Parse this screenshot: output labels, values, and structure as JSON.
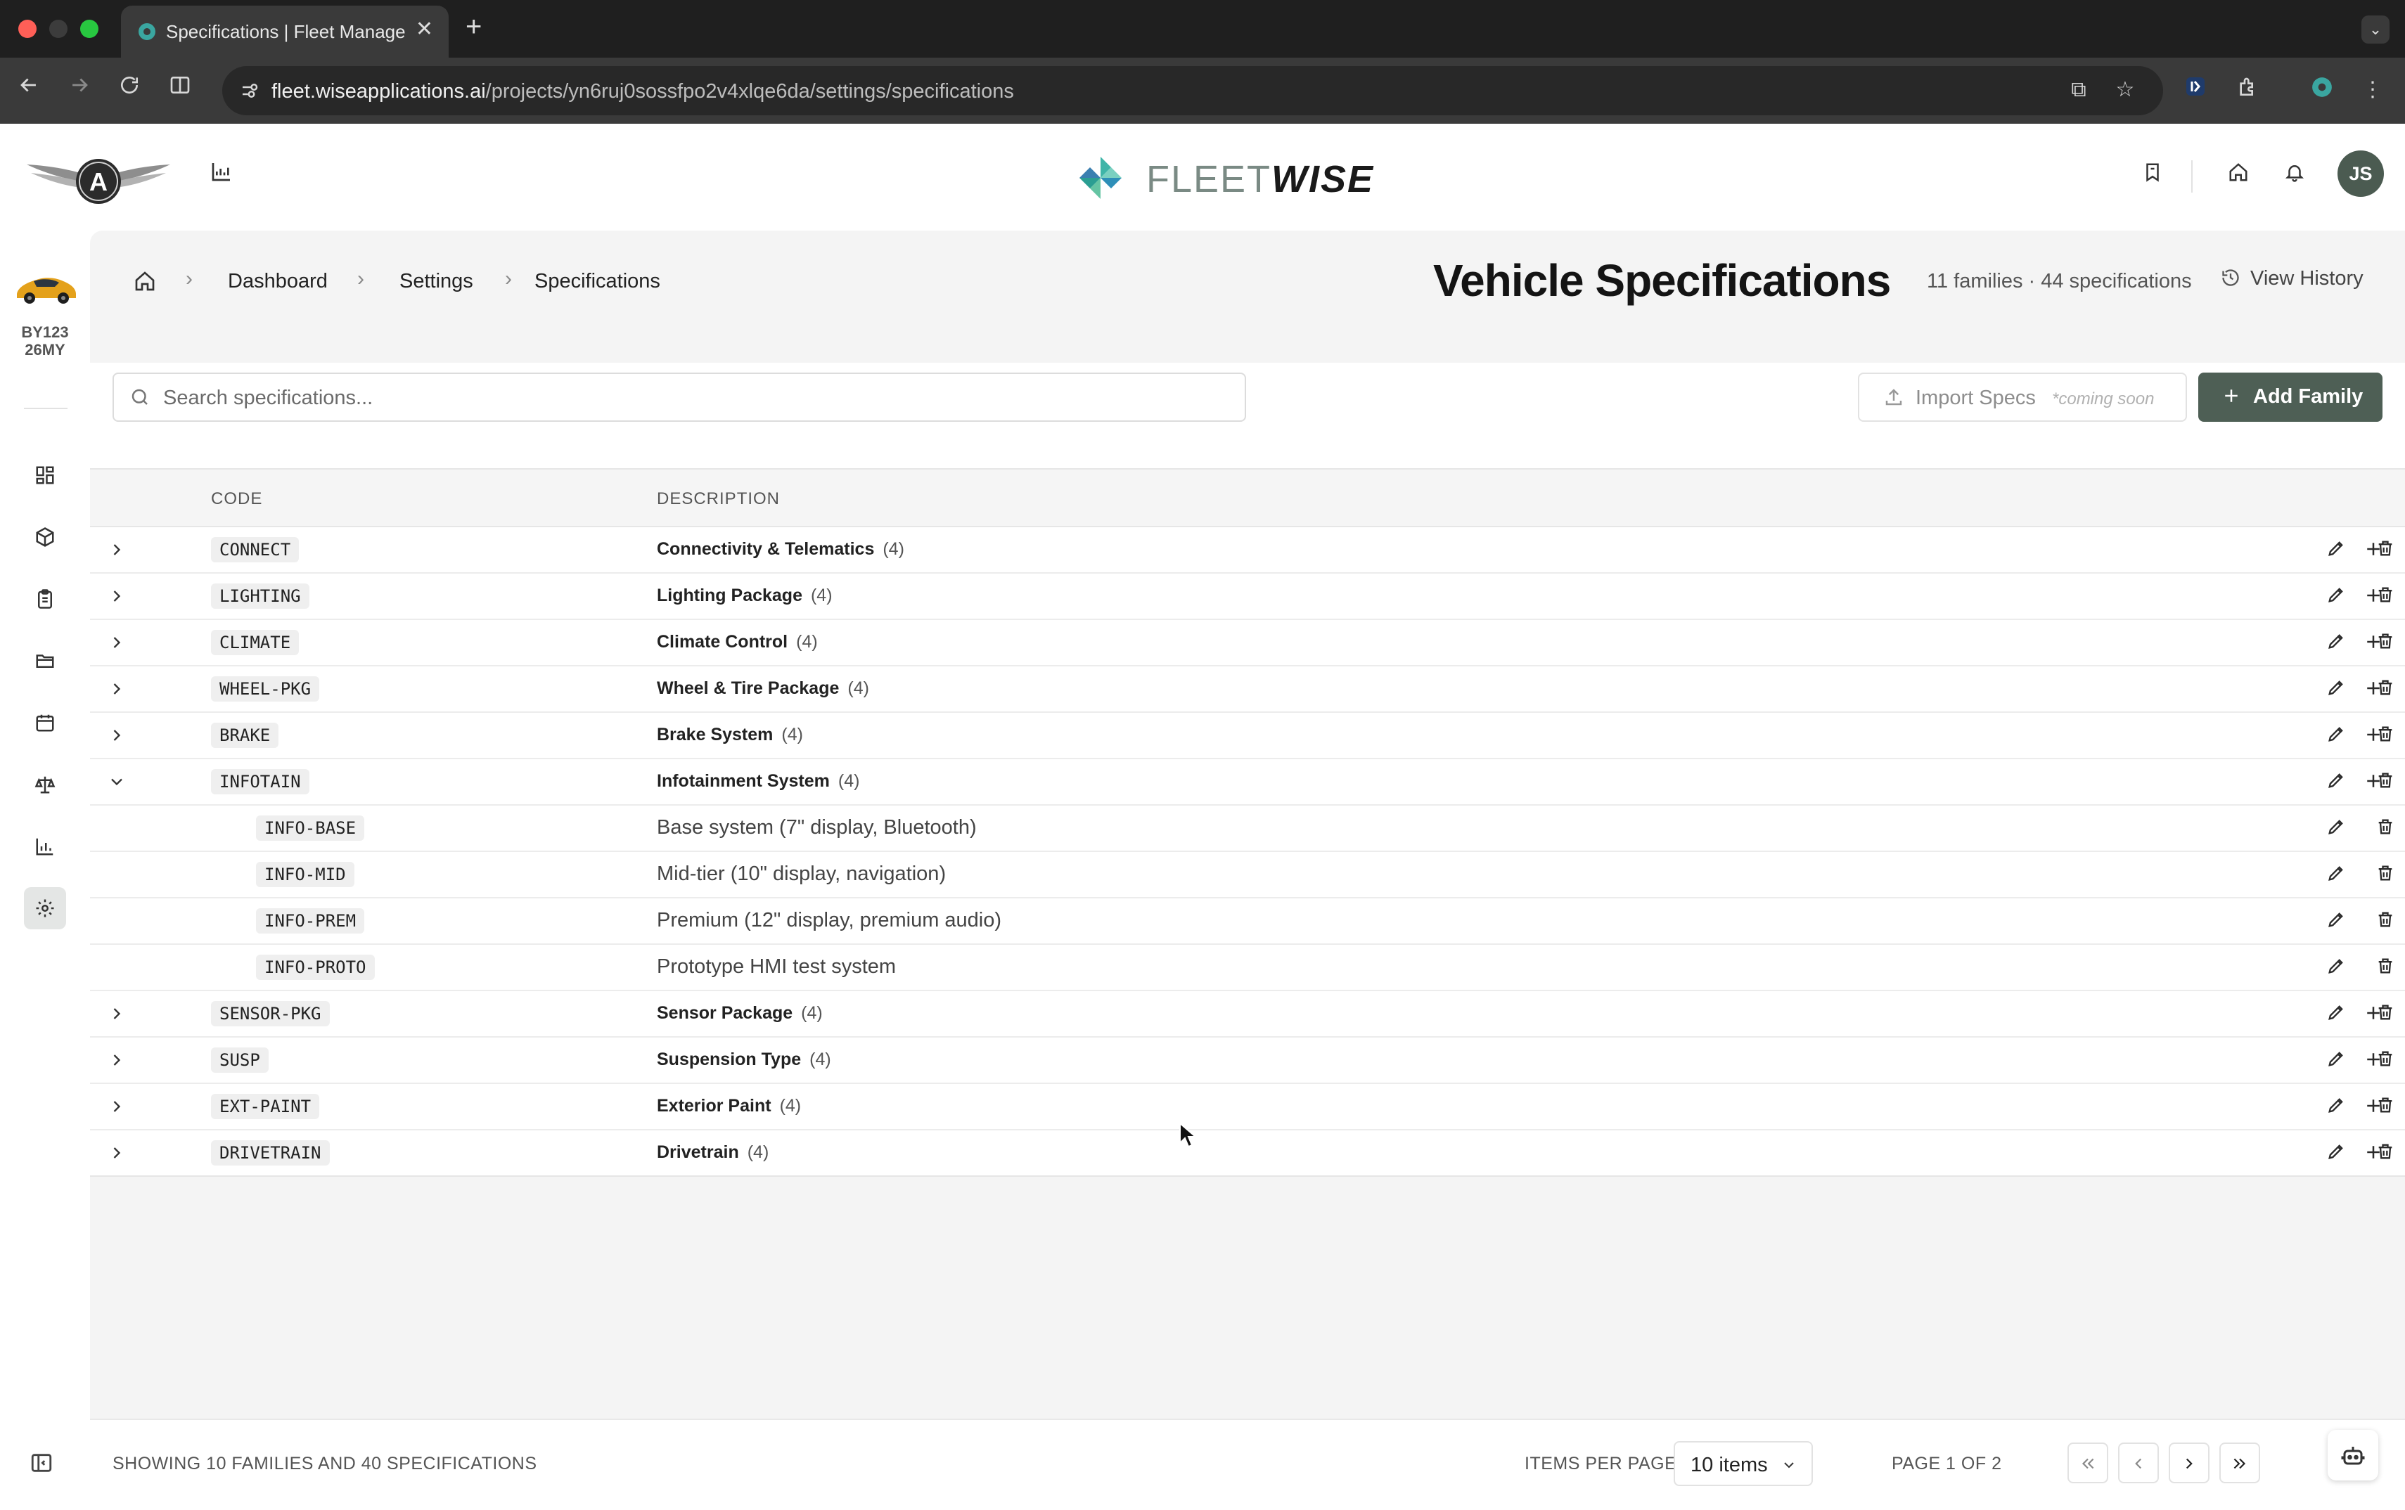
{
  "browser": {
    "tab_title": "Specifications | Fleet Management",
    "url_host": "fleet.wiseapplications.ai",
    "url_path": "/projects/yn6ruj0sossfpo2v4xlqe6da/settings/specifications",
    "colors": {
      "close": "#ff5f57",
      "minimize": "#3c3c3c",
      "maximize": "#28c840"
    }
  },
  "header": {
    "brand_light": "FLEET",
    "brand_bold": "WISE",
    "avatar_initials": "JS",
    "icons": [
      "wings-logo-icon",
      "chart-icon",
      "bookmark-icon",
      "home-icon",
      "bell-icon"
    ]
  },
  "sidebar": {
    "vehicle_line1": "BY123",
    "vehicle_line2": "26MY",
    "items": [
      "dashboard-icon",
      "package-icon",
      "clipboard-icon",
      "folder-icon",
      "calendar-icon",
      "scales-icon",
      "bar-chart-icon",
      "settings-icon"
    ],
    "active": "settings-icon"
  },
  "breadcrumb": {
    "items": [
      "Dashboard",
      "Settings",
      "Specifications"
    ]
  },
  "page": {
    "title": "Vehicle Specifications",
    "meta": "11 families · 44 specifications",
    "view_history": "View History"
  },
  "toolbar": {
    "search_placeholder": "Search specifications...",
    "import_label": "Import Specs",
    "import_note": "*coming soon",
    "add_family_label": "Add Family",
    "accent": "#4e5f55"
  },
  "table": {
    "headers": {
      "code": "CODE",
      "description": "DESCRIPTION"
    },
    "rows": [
      {
        "kind": "family",
        "code": "CONNECT",
        "description": "Connectivity & Telematics",
        "count": "(4)",
        "expanded": false
      },
      {
        "kind": "family",
        "code": "LIGHTING",
        "description": "Lighting Package",
        "count": "(4)",
        "expanded": false
      },
      {
        "kind": "family",
        "code": "CLIMATE",
        "description": "Climate Control",
        "count": "(4)",
        "expanded": false
      },
      {
        "kind": "family",
        "code": "WHEEL-PKG",
        "description": "Wheel & Tire Package",
        "count": "(4)",
        "expanded": false
      },
      {
        "kind": "family",
        "code": "BRAKE",
        "description": "Brake System",
        "count": "(4)",
        "expanded": false
      },
      {
        "kind": "family",
        "code": "INFOTAIN",
        "description": "Infotainment System",
        "count": "(4)",
        "expanded": true
      },
      {
        "kind": "spec",
        "code": "INFO-BASE",
        "description": "Base system (7\" display, Bluetooth)"
      },
      {
        "kind": "spec",
        "code": "INFO-MID",
        "description": "Mid-tier (10\" display, navigation)"
      },
      {
        "kind": "spec",
        "code": "INFO-PREM",
        "description": "Premium (12\" display, premium audio)"
      },
      {
        "kind": "spec",
        "code": "INFO-PROTO",
        "description": "Prototype HMI test system"
      },
      {
        "kind": "family",
        "code": "SENSOR-PKG",
        "description": "Sensor Package",
        "count": "(4)",
        "expanded": false
      },
      {
        "kind": "family",
        "code": "SUSP",
        "description": "Suspension Type",
        "count": "(4)",
        "expanded": false
      },
      {
        "kind": "family",
        "code": "EXT-PAINT",
        "description": "Exterior Paint",
        "count": "(4)",
        "expanded": false
      },
      {
        "kind": "family",
        "code": "DRIVETRAIN",
        "description": "Drivetrain",
        "count": "(4)",
        "expanded": false
      }
    ]
  },
  "footer": {
    "showing": "SHOWING 10 FAMILIES AND 40 SPECIFICATIONS",
    "items_per_page_label": "ITEMS PER PAGE",
    "items_per_page_value": "10 items",
    "page_info": "PAGE 1 OF 2"
  }
}
